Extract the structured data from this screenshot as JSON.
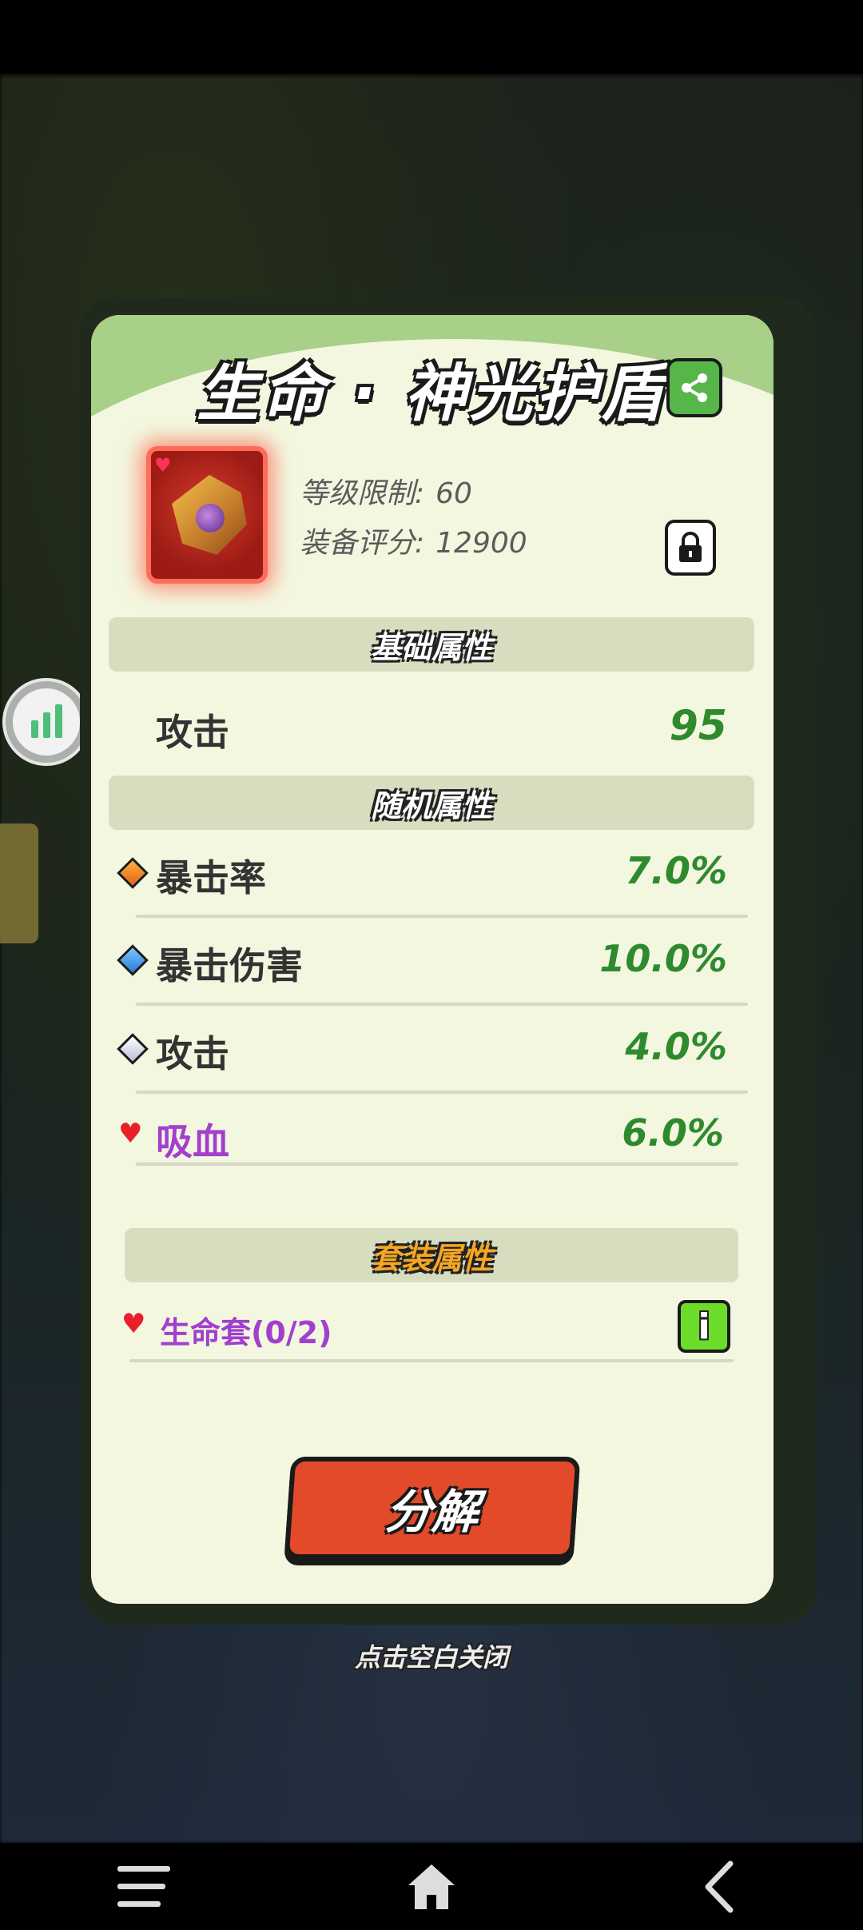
{
  "modal": {
    "title": "生命 · 神光护盾",
    "level_limit_label": "等级限制:",
    "level_limit_value": "60",
    "score_label": "装备评分:",
    "score_value": "12900"
  },
  "base_attributes": {
    "header": "基础属性",
    "items": [
      {
        "label": "攻击",
        "value": "95"
      }
    ]
  },
  "random_attributes": {
    "header": "随机属性",
    "items": [
      {
        "label": "暴击率",
        "value": "7.0%",
        "icon": "orange-diamond-icon"
      },
      {
        "label": "暴击伤害",
        "value": "10.0%",
        "icon": "blue-diamond-icon"
      },
      {
        "label": "攻击",
        "value": "4.0%",
        "icon": "white-diamond-icon"
      },
      {
        "label": "吸血",
        "value": "6.0%",
        "icon": "heart-icon"
      }
    ]
  },
  "set_attributes": {
    "header": "套装属性",
    "set_name": "生命套(0/2)",
    "info_label": "i"
  },
  "actions": {
    "decompose_label": "分解",
    "close_hint": "点击空白关闭"
  },
  "colors": {
    "panel_bg": "#f3f7df",
    "header_green": "#a8d089",
    "value_green": "#2f8a2f",
    "purple_text": "#a23fcf",
    "button_red": "#e24a2a",
    "set_header_orange": "#f5a623"
  }
}
